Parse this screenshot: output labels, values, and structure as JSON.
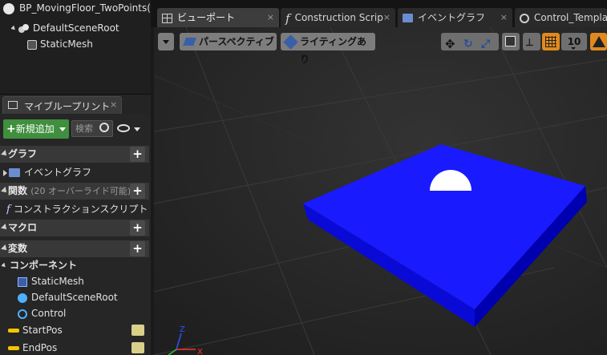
{
  "components_tree": {
    "blueprint_name": "BP_MovingFloor_TwoPoints(s",
    "root_label": "DefaultSceneRoot",
    "child_label": "StaticMesh"
  },
  "my_blueprint": {
    "tab_label": "マイブループリント",
    "tab_close": "×",
    "add_new_label": "新規追加",
    "search_placeholder": "検索",
    "sections": {
      "graphs": "グラフ",
      "event_graph": "イベントグラフ",
      "functions": "関数",
      "functions_sub": "(20 オーバーライド可能)",
      "construction_script": "コンストラクションスクリプト",
      "macros": "マクロ",
      "variables": "変数",
      "components": "コンポーネント"
    },
    "components": [
      "StaticMesh",
      "DefaultSceneRoot",
      "Control"
    ],
    "variables": [
      "StartPos",
      "EndPos"
    ],
    "plus": "+"
  },
  "editor_tabs": [
    {
      "label": "ビューポート",
      "close": "×"
    },
    {
      "label": "Construction Scrip",
      "close": "×"
    },
    {
      "label": "イベントグラフ",
      "close": "×"
    },
    {
      "label": "Control_Templa",
      "close": ""
    }
  ],
  "viewport_toolbar": {
    "perspective_label": "パースペクティブ",
    "lighting_label": "ライティングあり",
    "grid_snap_value": "10"
  },
  "axis_labels": {
    "x": "X",
    "z": "Z"
  },
  "colors": {
    "floor_top": "#1a1aff",
    "floor_front": "#0a0ad6",
    "floor_side": "#0000b0",
    "add_button": "#3f8f3f",
    "accent_orange": "#e08a1e"
  }
}
